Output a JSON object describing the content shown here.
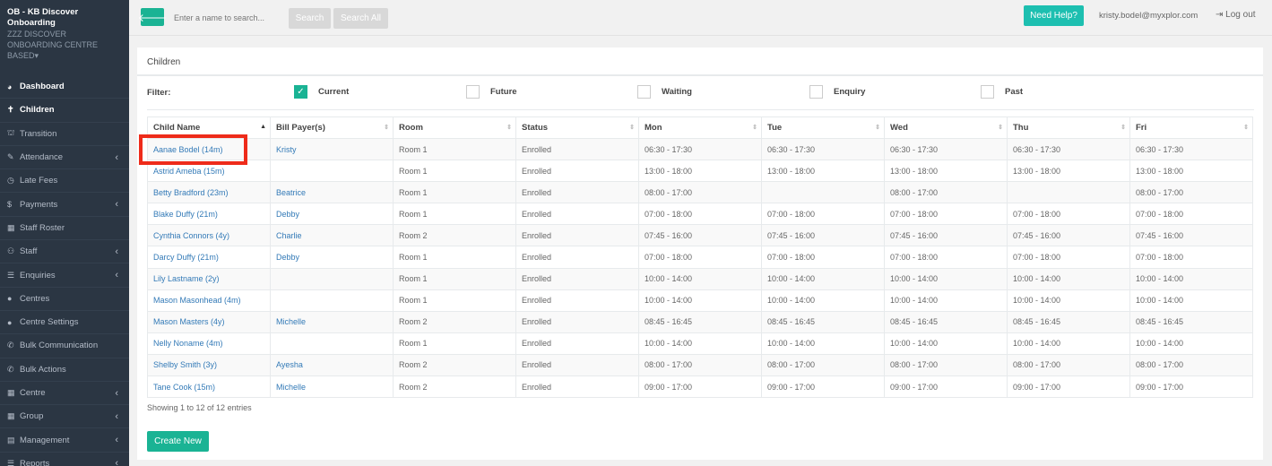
{
  "sidebar": {
    "org": "OB - KB Discover Onboarding",
    "centre": "zzz DISCOVER ONBOARDING CENTRE BASED",
    "items": [
      {
        "label": "Dashboard",
        "icon": "dashboard-icon",
        "glyph": "◕",
        "chevron": false
      },
      {
        "label": "Children",
        "icon": "child-icon",
        "glyph": "✝",
        "chevron": false
      },
      {
        "label": "Transition",
        "icon": "graduation-cap-icon",
        "glyph": "⛫",
        "chevron": false
      },
      {
        "label": "Attendance",
        "icon": "edit-icon",
        "glyph": "✎",
        "chevron": true
      },
      {
        "label": "Late Fees",
        "icon": "clock-icon",
        "glyph": "◷",
        "chevron": false
      },
      {
        "label": "Payments",
        "icon": "dollar-icon",
        "glyph": "$",
        "chevron": true
      },
      {
        "label": "Staff Roster",
        "icon": "calendar-icon",
        "glyph": "▦",
        "chevron": false
      },
      {
        "label": "Staff",
        "icon": "sitemap-icon",
        "glyph": "⚇",
        "chevron": true
      },
      {
        "label": "Enquiries",
        "icon": "list-icon",
        "glyph": "☰",
        "chevron": true
      },
      {
        "label": "Centres",
        "icon": "circle-icon",
        "glyph": "●",
        "chevron": false
      },
      {
        "label": "Centre Settings",
        "icon": "circle-icon",
        "glyph": "●",
        "chevron": false
      },
      {
        "label": "Bulk Communication",
        "icon": "bullhorn-icon",
        "glyph": "✆",
        "chevron": false
      },
      {
        "label": "Bulk Actions",
        "icon": "bullhorn-icon",
        "glyph": "✆",
        "chevron": false
      },
      {
        "label": "Centre",
        "icon": "grid-icon",
        "glyph": "▦",
        "chevron": true
      },
      {
        "label": "Group",
        "icon": "grid-icon",
        "glyph": "▦",
        "chevron": true
      },
      {
        "label": "Management",
        "icon": "table-icon",
        "glyph": "▤",
        "chevron": true
      },
      {
        "label": "Reports",
        "icon": "list-icon",
        "glyph": "☰",
        "chevron": true
      }
    ]
  },
  "topbar": {
    "search_placeholder": "Enter a name to search...",
    "search_label": "Search",
    "search_all_label": "Search All",
    "help_label": "Need Help?",
    "email": "kristy.bodel@myxplor.com",
    "logout_label": "Log out"
  },
  "panel": {
    "title": "Children",
    "filter_label": "Filter:",
    "filters": [
      {
        "label": "Current",
        "checked": true
      },
      {
        "label": "Future",
        "checked": false
      },
      {
        "label": "Waiting",
        "checked": false
      },
      {
        "label": "Enquiry",
        "checked": false
      },
      {
        "label": "Past",
        "checked": false
      }
    ],
    "columns": [
      "Child Name",
      "Bill Payer(s)",
      "Room",
      "Status",
      "Mon",
      "Tue",
      "Wed",
      "Thu",
      "Fri"
    ],
    "rows": [
      [
        "Aanae Bodel (14m)",
        "Kristy",
        "Room 1",
        "Enrolled",
        "06:30 - 17:30",
        "06:30 - 17:30",
        "06:30 - 17:30",
        "06:30 - 17:30",
        "06:30 - 17:30"
      ],
      [
        "Astrid Ameba (15m)",
        "",
        "Room 1",
        "Enrolled",
        "13:00 - 18:00",
        "13:00 - 18:00",
        "13:00 - 18:00",
        "13:00 - 18:00",
        "13:00 - 18:00"
      ],
      [
        "Betty Bradford (23m)",
        "Beatrice",
        "Room 1",
        "Enrolled",
        "08:00 - 17:00",
        "",
        "08:00 - 17:00",
        "",
        "08:00 - 17:00"
      ],
      [
        "Blake Duffy (21m)",
        "Debby",
        "Room 1",
        "Enrolled",
        "07:00 - 18:00",
        "07:00 - 18:00",
        "07:00 - 18:00",
        "07:00 - 18:00",
        "07:00 - 18:00"
      ],
      [
        "Cynthia Connors (4y)",
        "Charlie",
        "Room 2",
        "Enrolled",
        "07:45 - 16:00",
        "07:45 - 16:00",
        "07:45 - 16:00",
        "07:45 - 16:00",
        "07:45 - 16:00"
      ],
      [
        "Darcy Duffy (21m)",
        "Debby",
        "Room 1",
        "Enrolled",
        "07:00 - 18:00",
        "07:00 - 18:00",
        "07:00 - 18:00",
        "07:00 - 18:00",
        "07:00 - 18:00"
      ],
      [
        "Lily Lastname (2y)",
        "",
        "Room 1",
        "Enrolled",
        "10:00 - 14:00",
        "10:00 - 14:00",
        "10:00 - 14:00",
        "10:00 - 14:00",
        "10:00 - 14:00"
      ],
      [
        "Mason Masonhead (4m)",
        "",
        "Room 1",
        "Enrolled",
        "10:00 - 14:00",
        "10:00 - 14:00",
        "10:00 - 14:00",
        "10:00 - 14:00",
        "10:00 - 14:00"
      ],
      [
        "Mason Masters (4y)",
        "Michelle",
        "Room 2",
        "Enrolled",
        "08:45 - 16:45",
        "08:45 - 16:45",
        "08:45 - 16:45",
        "08:45 - 16:45",
        "08:45 - 16:45"
      ],
      [
        "Nelly Noname (4m)",
        "",
        "Room 1",
        "Enrolled",
        "10:00 - 14:00",
        "10:00 - 14:00",
        "10:00 - 14:00",
        "10:00 - 14:00",
        "10:00 - 14:00"
      ],
      [
        "Shelby Smith (3y)",
        "Ayesha",
        "Room 2",
        "Enrolled",
        "08:00 - 17:00",
        "08:00 - 17:00",
        "08:00 - 17:00",
        "08:00 - 17:00",
        "08:00 - 17:00"
      ],
      [
        "Tane Cook (15m)",
        "Michelle",
        "Room 2",
        "Enrolled",
        "09:00 - 17:00",
        "09:00 - 17:00",
        "09:00 - 17:00",
        "09:00 - 17:00",
        "09:00 - 17:00"
      ]
    ],
    "info": "Showing 1 to 12 of 12 entries",
    "create_label": "Create New"
  },
  "colors": {
    "accent": "#1ab394",
    "help": "#1dbfb0",
    "sidebar": "#2b3643",
    "highlight": "#ee2b1a",
    "link": "#337ab7"
  }
}
